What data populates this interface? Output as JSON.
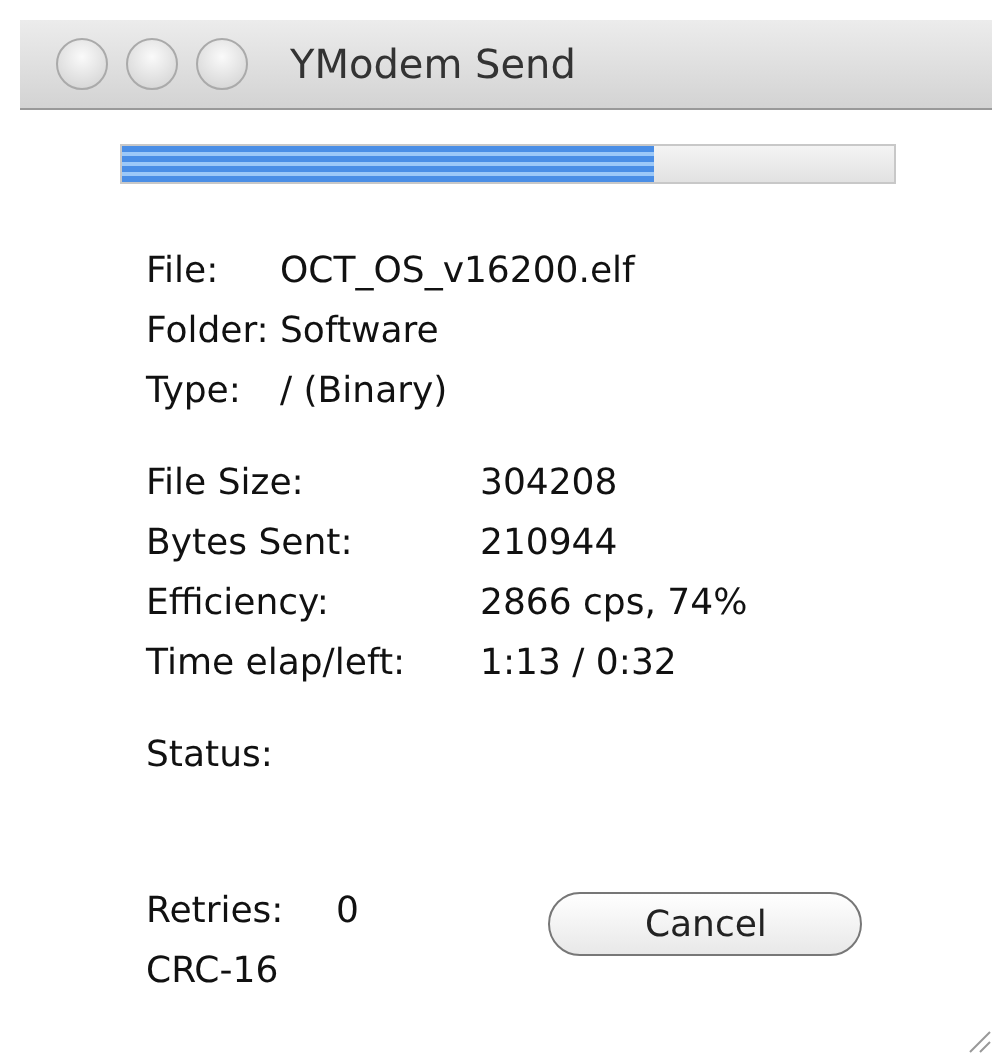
{
  "window": {
    "title": "YModem Send"
  },
  "progress": {
    "level": 0.69
  },
  "file_info": [
    {
      "label": "File:",
      "value": "OCT_OS_v16200.elf"
    },
    {
      "label": "Folder:",
      "value": "Software"
    },
    {
      "label": "Type:",
      "value": "/  (Binary)"
    }
  ],
  "stats": [
    {
      "label": "File Size:",
      "value": "304208"
    },
    {
      "label": "Bytes Sent:",
      "value": "210944"
    },
    {
      "label": "Efficiency:",
      "value": "2866 cps, 74%"
    },
    {
      "label": "Time elap/left:",
      "value": "1:13 / 0:32"
    }
  ],
  "status": {
    "label": "Status:"
  },
  "retries": {
    "label": "Retries:",
    "value": "0"
  },
  "checksum": "CRC-16",
  "buttons": [
    {
      "label": "Cancel"
    }
  ]
}
